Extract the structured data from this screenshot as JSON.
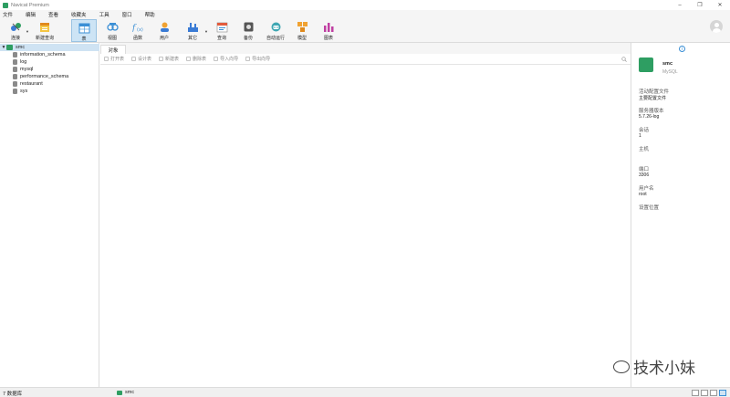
{
  "window": {
    "title": "Navicat Premium"
  },
  "menu": [
    "文件",
    "编辑",
    "查看",
    "收藏夹",
    "工具",
    "窗口",
    "帮助"
  ],
  "toolbar": {
    "items": [
      {
        "label": "连接",
        "icon": "connect-icon"
      },
      {
        "label": "新建查询",
        "icon": "new-query-icon"
      },
      {
        "label": "表",
        "icon": "table-icon"
      },
      {
        "label": "视图",
        "icon": "view-icon"
      },
      {
        "label": "函数",
        "icon": "function-icon"
      },
      {
        "label": "用户",
        "icon": "user-icon"
      },
      {
        "label": "其它",
        "icon": "other-icon"
      },
      {
        "label": "查询",
        "icon": "query-icon"
      },
      {
        "label": "备份",
        "icon": "backup-icon"
      },
      {
        "label": "自动运行",
        "icon": "automation-icon"
      },
      {
        "label": "模型",
        "icon": "model-icon"
      },
      {
        "label": "图表",
        "icon": "chart-icon"
      }
    ],
    "active": "表"
  },
  "tree": {
    "connection": "smc",
    "databases": [
      "information_schema",
      "log",
      "mysql",
      "performance_schema",
      "restaurant",
      "sys"
    ]
  },
  "tabs": {
    "objects": "对象"
  },
  "object_actions": [
    "打开表",
    "设计表",
    "新建表",
    "删除表",
    "导入向导",
    "导出向导"
  ],
  "info": {
    "name": "smc",
    "type": "MySQL",
    "fields": [
      {
        "label": "活动配置文件",
        "value": "主要配置文件"
      },
      {
        "label": "服务器版本",
        "value": "5.7.26-log"
      },
      {
        "label": "会话",
        "value": "1"
      },
      {
        "label": "主机",
        "value": ""
      },
      {
        "label": "端口",
        "value": "3306"
      },
      {
        "label": "用户名",
        "value": "root"
      },
      {
        "label": "设置位置",
        "value": ""
      }
    ]
  },
  "status": {
    "db_count": "7 数据库",
    "connection": "smc"
  },
  "watermark": "技术小妹",
  "colors": {
    "connection_green": "#2e9e62",
    "selection_blue": "#cfe3f3",
    "accent": "#3b8fd5"
  }
}
